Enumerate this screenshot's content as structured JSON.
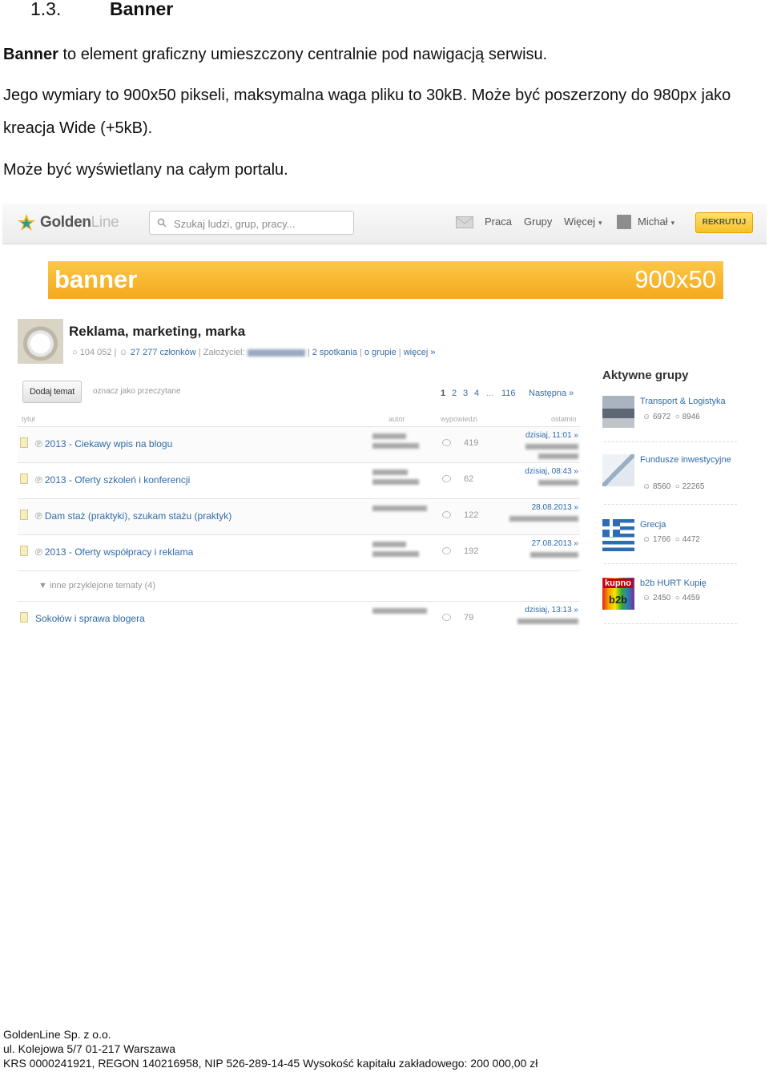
{
  "heading": {
    "number": "1.3.",
    "title": "Banner"
  },
  "paragraphs": {
    "p1_bold": "Banner",
    "p1_rest": " to element graficzny umieszczony centralnie pod nawigacją serwisu.",
    "p2": "Jego wymiary to 900x50 pikseli, maksymalna waga pliku to 30kB. Może być poszerzony do 980px jako kreacja Wide (+5kB).",
    "p3": "Może być wyświetlany na całym portalu."
  },
  "screenshot": {
    "logo": {
      "text_main": "Golden",
      "text_dim": "Line"
    },
    "search": {
      "placeholder": "Szukaj ludzi, grup, pracy..."
    },
    "nav": {
      "praca": "Praca",
      "grupy": "Grupy",
      "wiecej": "Więcej",
      "user": "Michał",
      "caret": "▾",
      "rekrutuj": "REKRUTUJ"
    },
    "banner": {
      "label": "banner",
      "size": "900x50",
      "color": "#f7b52c"
    },
    "group": {
      "title": "Reklama, marketing, marka",
      "posts": "104 052",
      "members": "27 277 członków",
      "founder_label": "Założyciel:",
      "meetings": "2 spotkania",
      "about": "o grupie",
      "more": "więcej »",
      "sep": "|"
    },
    "toolbar": {
      "add_topic": "Dodaj temat",
      "mark_read": "oznacz jako przeczytane",
      "pages": [
        "1",
        "2",
        "3",
        "4"
      ],
      "ellipsis": "...",
      "last_page": "116",
      "next": "Następna »"
    },
    "columns": {
      "title": "tytuł",
      "author": "autor",
      "replies": "wypowiedzi",
      "last": "ostatnio"
    },
    "topics": [
      {
        "title": "2013 - Ciekawy wpis na blogu",
        "replies": "419",
        "date": "dzisiaj, 11:01 »"
      },
      {
        "title": "2013 - Oferty szkoleń i konferencji",
        "replies": "62",
        "date": "dzisiaj, 08:43 »"
      },
      {
        "title": "Dam staż (praktyki), szukam stażu (praktyk)",
        "replies": "122",
        "date": "28.08.2013 »"
      },
      {
        "title": "2013 - Oferty współpracy i reklama",
        "replies": "192",
        "date": "27.08.2013 »"
      }
    ],
    "other_pinned": "▼  inne przyklejone tematy (4)",
    "last_topic": {
      "title": "Sokołów i sprawa blogera",
      "replies": "79",
      "date": "dzisiaj, 13:13 »"
    },
    "sidebar": {
      "title": "Aktywne grupy",
      "groups": [
        {
          "name": "Transport & Logistyka",
          "members": "6972",
          "posts": "8946"
        },
        {
          "name": "Fundusze inwestycyjne",
          "members": "8560",
          "posts": "22265"
        },
        {
          "name": "Grecja",
          "members": "1766",
          "posts": "4472"
        },
        {
          "name": "b2b HURT Kupię",
          "members": "2450",
          "posts": "4459"
        }
      ],
      "b2b_thumb": {
        "top": "kupno",
        "bottom": "b2b"
      }
    }
  },
  "footer": {
    "line1": "GoldenLine Sp. z o.o.",
    "line2": "ul. Kolejowa 5/7  01-217 Warszawa",
    "line3": "KRS 0000241921, REGON 140216958, NIP 526-289-14-45 Wysokość kapitału zakładowego: 200 000,00 zł"
  }
}
